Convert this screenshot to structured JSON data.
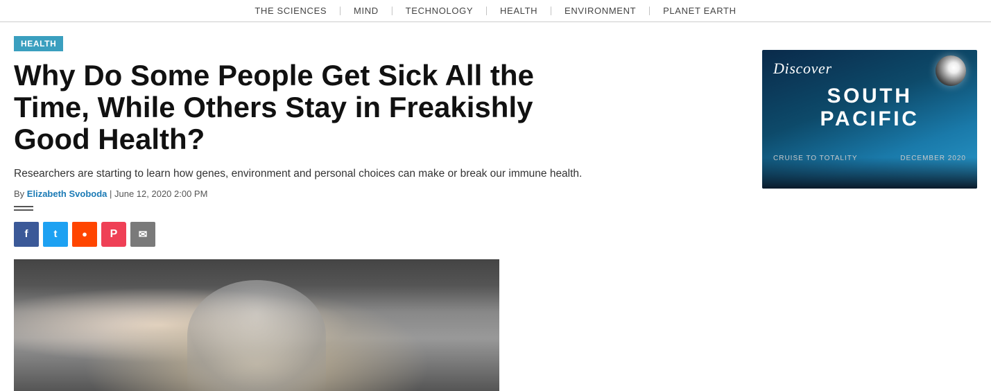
{
  "nav": {
    "items": [
      {
        "label": "THE SCIENCES"
      },
      {
        "label": "MIND"
      },
      {
        "label": "TECHNOLOGY"
      },
      {
        "label": "HEALTH"
      },
      {
        "label": "ENVIRONMENT"
      },
      {
        "label": "PLANET EARTH"
      }
    ]
  },
  "article": {
    "category": "HEALTH",
    "title": "Why Do Some People Get Sick All the Time, While Others Stay in Freakishly Good Health?",
    "subtitle": "Researchers are starting to learn how genes, environment and personal choices can make or break our immune health.",
    "byline_prefix": "By",
    "author": "Elizabeth Svoboda",
    "date": "June 12, 2020 2:00 PM"
  },
  "social": {
    "facebook_label": "f",
    "twitter_label": "t",
    "reddit_label": "r",
    "pocket_label": "P",
    "email_label": "✉"
  },
  "ad": {
    "discover": "Discover",
    "south_pacific_line1": "SOUTH",
    "south_pacific_line2": "PACIFIC",
    "cruise": "CRUISE TO TOTALITY",
    "date": "DECEMBER 2020"
  }
}
